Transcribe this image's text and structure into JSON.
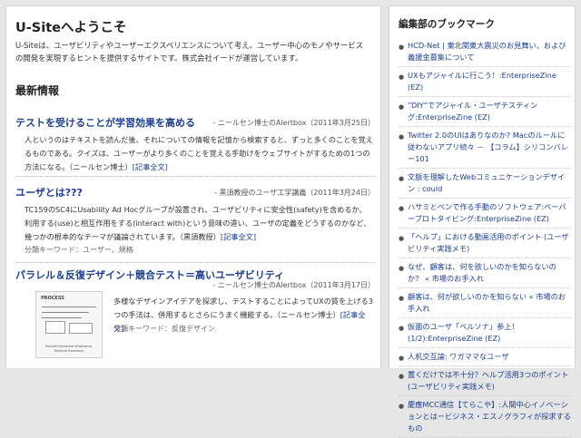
{
  "welcome": {
    "title": "U-Siteへようこそ",
    "intro": "U-Siteは、ユーザビリティやユーザーエクスペリエンスについて考え、ユーザー中心のモノやサービスの開発を実現するヒントを提供するサイトです。株式会社イードが運営しています。"
  },
  "news": {
    "heading": "最新情報",
    "articles": [
      {
        "title": "テストを受けることが学習効果を高める",
        "meta": "- ニールセン博士のAlertbox（2011年3月25日）",
        "body": "人というのはテキストを読んだ後、それについての情報を記憶から検索すると、ずっと多くのことを覚えるものである。クイズは、ユーザーがより多くのことを覚える手助けをウェブサイトがするための1つの方法になる。（ニールセン博士）",
        "link": "[記事全文]",
        "keywords": ""
      },
      {
        "title": "ユーザとは???",
        "meta": "- 黒須教授のユーザ工学講義（2011年3月24日）",
        "body": "TC159のSC4にUsability Ad Hocグループが設置され、ユーザビリティに安全性(safety)を含めるか、利用する(use)と相互作用をする(interact with)という意味の違い、ユーザの定義をどうするのかなど、幾つかの根本的なテーマが議論されています。（黒須教授）",
        "link": "[記事全文]",
        "keywords": "分類キーワード：ユーザー、規格"
      },
      {
        "title": "パラレル＆反復デザイン＋競合テスト＝高いユーザビリティ",
        "meta": "- ニールセン博士のAlertbox（2011年3月17日）",
        "body": "多様なデザインアイデアを探求し、テストすることによってUXの質を上げる3つの手法は、併用するとさらにうまく機能する。（ニールセン博士）",
        "link": "[記事全文]",
        "keywords": "分類キーワード：反復デザイン",
        "thumb_label": "PROCESS",
        "thumb_caption": "Parallel+Iterative Wireframe, Multiple iterations"
      }
    ]
  },
  "bookmarks": {
    "title": "編集部のブックマーク",
    "items": [
      "HCD-Net | 東北関東大震災のお見舞い、および義援金募集について",
      "UXもアジャイルに行こう！:EnterpriseZine (EZ)",
      "“DIY”でアジャイル・ユーザテスティング:EnterpriseZine (EZ)",
      "Twitter 2.0のUIはありなのか? Macのルールに従わないアプリ続々 － 【コラム】シリコンバレー101",
      "文脈を理解したWebコミュニケーションデザイン : could",
      "ハサミとペンで作る手動のソフトウェア:ペーパープロトタイピング:EnterpriseZine (EZ)",
      "「ヘルプ」における動画活用のポイント (ユーザビリティ実践メモ)",
      "なぜ、顧客は、何を欲しいのかを知らないのか？ « 市場のお手入れ",
      "顧客は、何が欲しいのかを知らない « 市場のお手入れ",
      "仮面のユーザ「ペルソナ」参上！ (1/2):EnterpriseZine (EZ)",
      "人机交互論: ワガママなユーザ",
      "置くだけでは不十分？ヘルプ活用3つのポイント (ユーザビリティ実践メモ)",
      "慶應MCC通信【てらこや】:人間中心イノベーションとはービジネス・エスノグラフィが探求するもの"
    ]
  },
  "colors": {
    "link": "#1c3f94",
    "background": "#e6e6e6",
    "panel": "#ffffff"
  }
}
